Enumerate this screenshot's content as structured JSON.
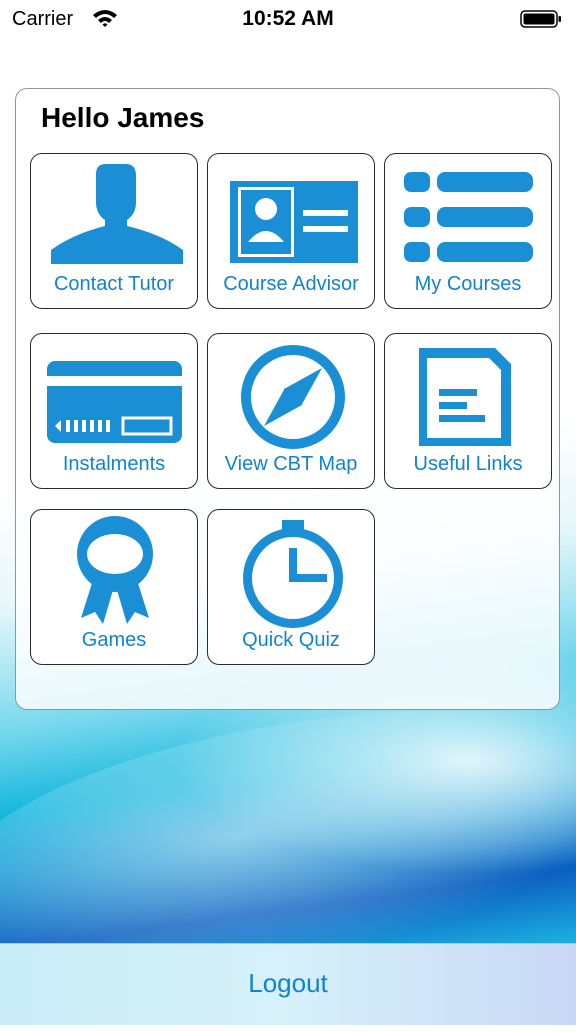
{
  "status_bar": {
    "carrier": "Carrier",
    "time": "10:52 AM"
  },
  "greeting": "Hello James",
  "tiles": [
    {
      "label": "Contact Tutor",
      "icon": "person-icon"
    },
    {
      "label": "Course Advisor",
      "icon": "id-card-icon"
    },
    {
      "label": "My Courses",
      "icon": "list-icon"
    },
    {
      "label": "Instalments",
      "icon": "credit-card-icon"
    },
    {
      "label": "View CBT Map",
      "icon": "compass-icon"
    },
    {
      "label": "Useful Links",
      "icon": "document-icon"
    },
    {
      "label": "Games",
      "icon": "award-ribbon-icon"
    },
    {
      "label": "Quick Quiz",
      "icon": "stopwatch-icon"
    }
  ],
  "logout_label": "Logout",
  "colors": {
    "accent": "#1183d0",
    "icon_blue": "#1a8fd6"
  }
}
